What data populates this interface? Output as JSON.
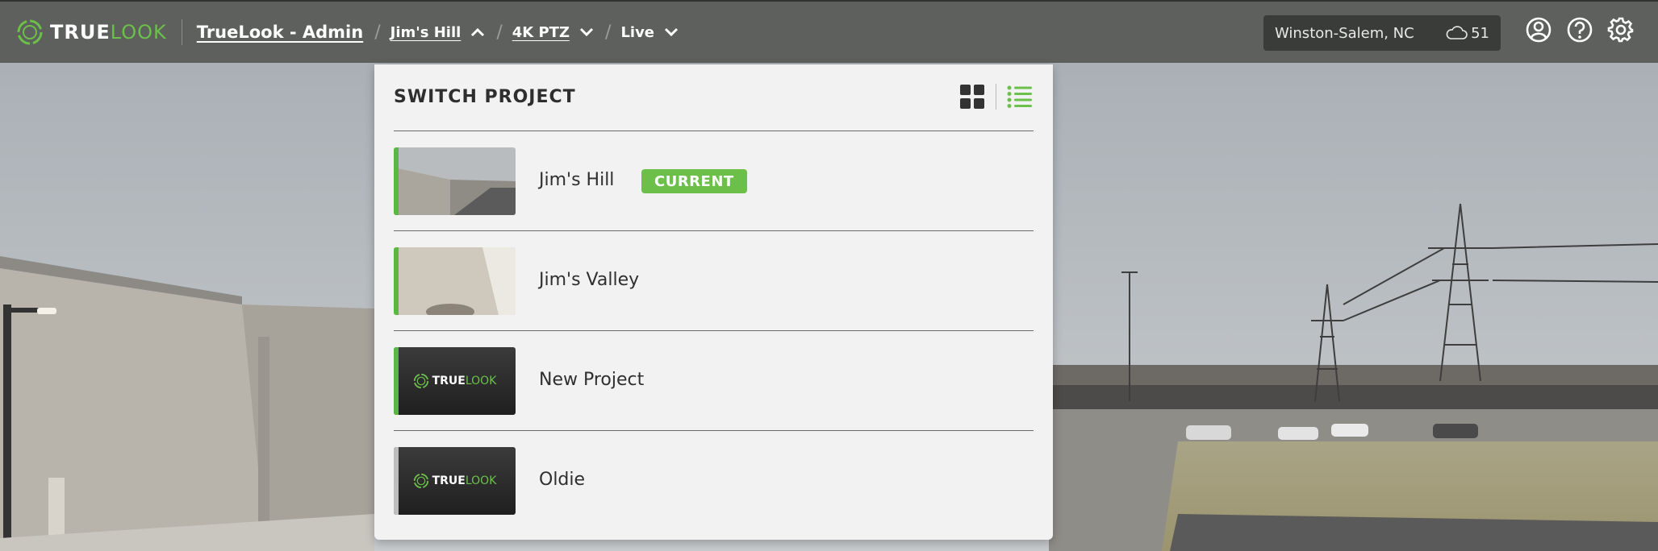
{
  "brand": {
    "logo_true": "TRUE",
    "logo_look": "LOOK",
    "accent_color": "#6cc04a",
    "bar_color": "#5d605c"
  },
  "breadcrumb": {
    "admin": "TrueLook - Admin",
    "project": "Jim's Hill",
    "camera": "4K PTZ",
    "mode": "Live"
  },
  "location": {
    "city": "Winston-Salem, NC",
    "weather_icon": "cloud-icon",
    "temperature": "51"
  },
  "top_icons": [
    "user-icon",
    "help-icon",
    "settings-gear-icon"
  ],
  "switch_panel": {
    "title": "SWITCH PROJECT",
    "view_options": [
      "grid-view-icon",
      "list-view-icon"
    ],
    "active_view": "list",
    "projects": [
      {
        "name": "Jim's Hill",
        "badge": "CURRENT",
        "thumb": "camera-photo",
        "status": "active"
      },
      {
        "name": "Jim's Valley",
        "badge": "",
        "thumb": "camera-photo",
        "status": "active"
      },
      {
        "name": "New Project",
        "badge": "",
        "thumb": "truelook-logo",
        "status": "active"
      },
      {
        "name": "Oldie",
        "badge": "",
        "thumb": "truelook-logo",
        "status": "inactive"
      }
    ]
  }
}
